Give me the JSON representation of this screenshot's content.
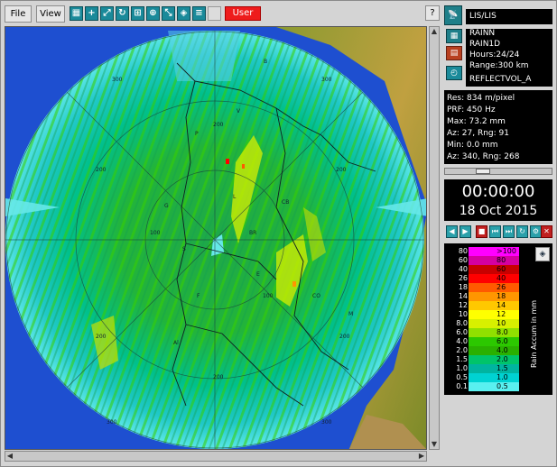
{
  "toolbar": {
    "file_label": "File",
    "view_label": "View",
    "user_label": "User",
    "help_label": "?",
    "tools": [
      "grid-tool-icon",
      "crosshair-tool-icon",
      "zoom-tool-icon",
      "rotate-tool-icon",
      "measure-tool-icon",
      "profile-tool-icon",
      "range-tool-icon",
      "overlay-tool-icon",
      "layers-tool-icon",
      "blank-tool-icon"
    ]
  },
  "map": {
    "range_labels": [
      "300",
      "300",
      "200",
      "200",
      "200",
      "200",
      "200",
      "200",
      "100",
      "100",
      "300",
      "300"
    ],
    "place_labels": [
      "V",
      "B",
      "E",
      "CB",
      "L",
      "F",
      "Al",
      "S",
      "P",
      "M",
      "CO",
      "BR",
      "G"
    ]
  },
  "panel": {
    "radar_name": "LIS/LIS",
    "product_1": "RAINN",
    "product_2": "RAIN1D",
    "hours": "Hours:24/24",
    "range": "Range:300 km",
    "reflect": "REFLECTVOL_A",
    "res": "Res: 834 m/pixel",
    "prf": "PRF: 450 Hz",
    "max": "Max: 73.2 mm",
    "max_az": "Az:  27, Rng: 91",
    "min": "Min:  0.0 mm",
    "min_az": "Az:  340, Rng: 268",
    "time": "00:00:00",
    "date": "18 Oct 2015"
  },
  "legend": {
    "unit": "Rain Accum in mm",
    "rows": [
      {
        "left": "80",
        "right": ">100",
        "color": "#ff00ff"
      },
      {
        "left": "60",
        "right": "80",
        "color": "#d400a0"
      },
      {
        "left": "40",
        "right": "60",
        "color": "#c80000"
      },
      {
        "left": "26",
        "right": "40",
        "color": "#ff0000"
      },
      {
        "left": "18",
        "right": "26",
        "color": "#ff5a00"
      },
      {
        "left": "14",
        "right": "18",
        "color": "#ff9600"
      },
      {
        "left": "12",
        "right": "14",
        "color": "#ffc800"
      },
      {
        "left": "10",
        "right": "12",
        "color": "#ffff00"
      },
      {
        "left": "8.0",
        "right": "10",
        "color": "#d8f000"
      },
      {
        "left": "6.0",
        "right": "8.0",
        "color": "#90e000"
      },
      {
        "left": "4.0",
        "right": "6.0",
        "color": "#2cc800"
      },
      {
        "left": "2.0",
        "right": "4.0",
        "color": "#2ab000"
      },
      {
        "left": "1.5",
        "right": "2.0",
        "color": "#00c46a"
      },
      {
        "left": "1.0",
        "right": "1.5",
        "color": "#00b4a0"
      },
      {
        "left": "0.5",
        "right": "1.0",
        "color": "#00d2d2"
      },
      {
        "left": "0.1",
        "right": "0.5",
        "color": "#5af0f0"
      }
    ]
  },
  "colors": {
    "accent": "#1a8a9a",
    "user_button": "#ee1c1c",
    "panel_bg": "#000000"
  }
}
